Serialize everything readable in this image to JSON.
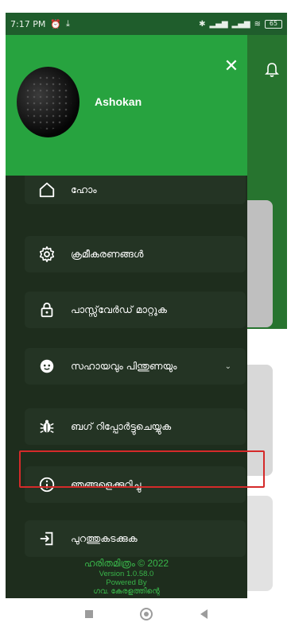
{
  "status_bar": {
    "time": "7:17 PM",
    "battery": "65"
  },
  "drawer": {
    "username": "Ashokan",
    "menu": [
      {
        "label": "ഹോം",
        "icon": "home-icon"
      },
      {
        "label": "ക്രമീകരണങ്ങൾ",
        "icon": "gear-icon"
      },
      {
        "label": "പാസ്സ്‌വേർഡ് മാറ്റുക",
        "icon": "lock-icon"
      },
      {
        "label": "സഹായവും പിന്തുണയും",
        "icon": "support-icon"
      },
      {
        "label": "ബഗ് റിപ്പോർട്ടുചെയ്യുക",
        "icon": "bug-icon"
      },
      {
        "label": "ഞങ്ങളെക്കുറിച്ചു",
        "icon": "info-icon"
      },
      {
        "label": "പുറത്തുകടക്കുക",
        "icon": "logout-icon"
      }
    ],
    "footer": {
      "brand": "ഹരിതമിത്രം © 2022",
      "version": "Version 1.0.58.0",
      "powered_by": "Powered By",
      "org": "ഗവ. കേരളത്തിന്റെ"
    }
  },
  "colors": {
    "drawer_header": "#27a33f",
    "drawer_bg": "#1e2d1d",
    "item_bg": "#243424",
    "highlight": "#d52a2a"
  }
}
